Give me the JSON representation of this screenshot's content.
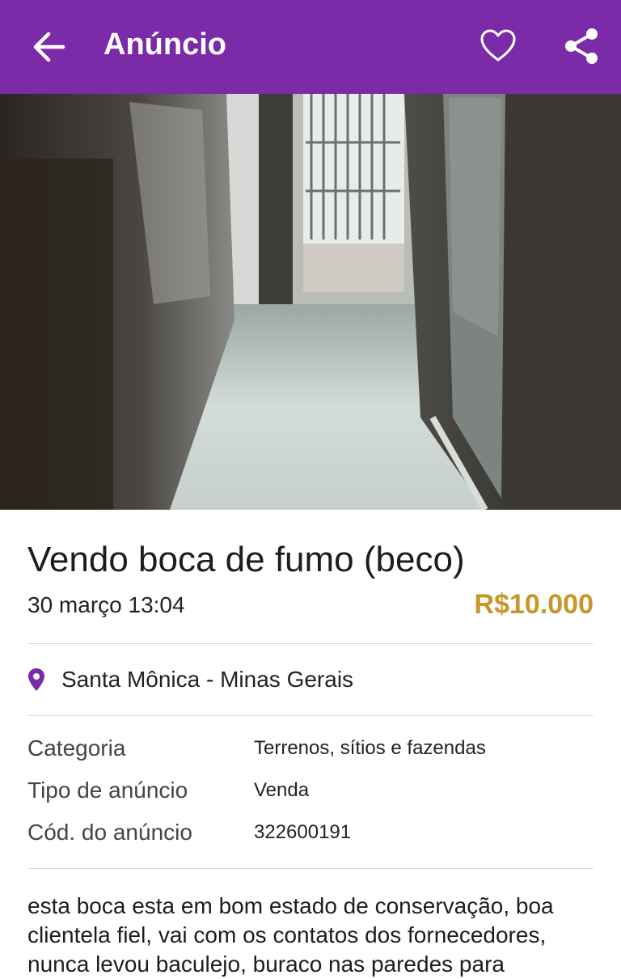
{
  "header": {
    "title": "Anúncio",
    "icons": {
      "back": "arrow-left-icon",
      "favorite": "heart-icon",
      "share": "share-icon"
    },
    "background": "#7b2aa8"
  },
  "photo": {
    "icon": "alley-photo"
  },
  "ad": {
    "title": "Vendo boca de fumo (beco)",
    "date": "30 março 13:04",
    "price": "R$10.000",
    "price_color": "#c9962a",
    "location": "Santa Mônica - Minas Gerais",
    "location_icon": "map-pin-icon"
  },
  "details": [
    {
      "label": "Categoria",
      "value": "Terrenos, sítios e fazendas"
    },
    {
      "label": "Tipo de anúncio",
      "value": "Venda"
    },
    {
      "label": "Cód. do anúncio",
      "value": "322600191"
    }
  ],
  "description": "esta boca esta em bom estado de conservação, boa clientela fiel, vai com os contatos dos fornecedores, nunca levou baculejo, buraco nas paredes para"
}
